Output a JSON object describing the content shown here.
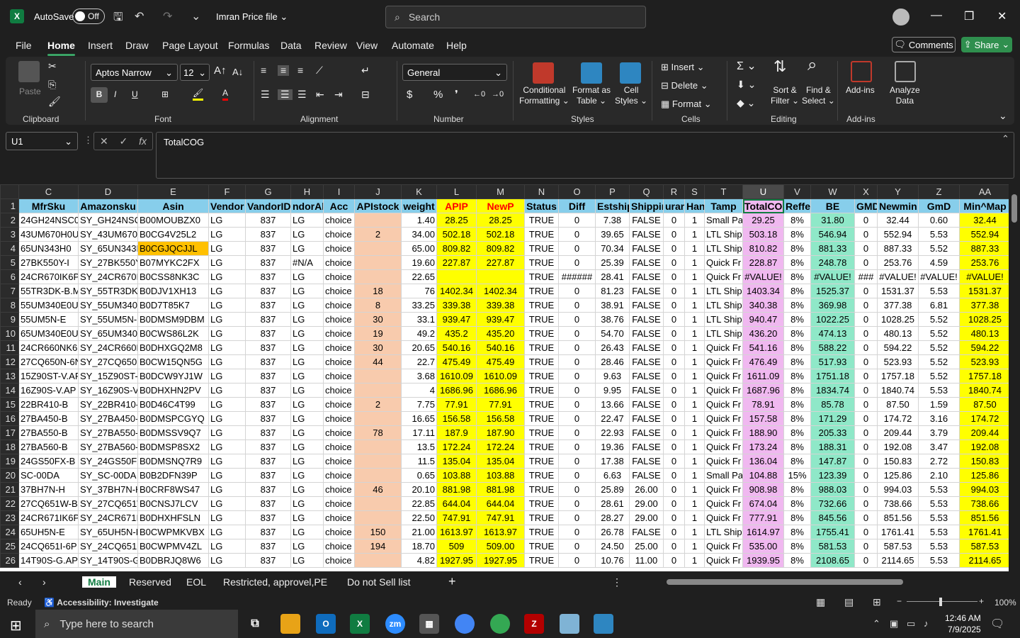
{
  "titlebar": {
    "autosave_label": "AutoSave",
    "autosave_state": "Off",
    "filename": "Imran Price file",
    "search_placeholder": "Search"
  },
  "menu": {
    "items": [
      "File",
      "Home",
      "Insert",
      "Draw",
      "Page Layout",
      "Formulas",
      "Data",
      "Review",
      "View",
      "Automate",
      "Help"
    ],
    "active": "Home",
    "comments": "Comments",
    "share": "Share"
  },
  "ribbon": {
    "clipboard": {
      "paste": "Paste",
      "label": "Clipboard"
    },
    "font": {
      "name": "Aptos Narrow",
      "size": "12",
      "label": "Font"
    },
    "alignment": {
      "label": "Alignment"
    },
    "number": {
      "format": "General",
      "label": "Number"
    },
    "styles": {
      "conditional": [
        "Conditional",
        "Formatting"
      ],
      "format_table": [
        "Format as",
        "Table"
      ],
      "cell_styles": [
        "Cell",
        "Styles"
      ],
      "label": "Styles"
    },
    "cells": {
      "insert": "Insert",
      "delete": "Delete",
      "format": "Format",
      "label": "Cells"
    },
    "editing": {
      "sort": [
        "Sort &",
        "Filter"
      ],
      "find": [
        "Find &",
        "Select"
      ],
      "label": "Editing"
    },
    "addins": {
      "addins": "Add-ins",
      "label": "Add-ins",
      "analyze": [
        "Analyze",
        "Data"
      ]
    }
  },
  "formula": {
    "namebox": "U1",
    "content": "TotalCOG"
  },
  "sheet": {
    "columns": [
      "C",
      "D",
      "E",
      "F",
      "G",
      "H",
      "I",
      "J",
      "K",
      "L",
      "M",
      "N",
      "O",
      "P",
      "Q",
      "R",
      "S",
      "T",
      "U",
      "V",
      "W",
      "X",
      "Y",
      "Z",
      "AA"
    ],
    "headers": [
      "MfrSku",
      "Amazonsku",
      "Asin",
      "Vendor",
      "VandorID",
      "ndorAll",
      "Acc",
      "APIstock",
      "weight",
      "APIP",
      "NewP",
      "Status",
      "Diff",
      "Estship",
      "Shippin",
      "uran",
      "Han",
      "Tamp",
      "TotalCOG",
      "Reffe",
      "BE",
      "GMD",
      "Newmin",
      "GmD",
      "Min^Map"
    ],
    "rows": [
      [
        "24GH24NSC0R",
        "SY_GH24NSC0R",
        "B00MOUBZX0",
        "LG",
        "837",
        "LG",
        "choice",
        "",
        "1.40",
        "28.25",
        "28.25",
        "TRUE",
        "0",
        "7.38",
        "FALSE",
        "0",
        "1",
        "Small Pa",
        "29.25",
        "8%",
        "31.80",
        "0",
        "32.44",
        "0.60",
        "32.44"
      ],
      [
        "43UM670H0U",
        "SY_43UM670H",
        "B0CG4V25L2",
        "LG",
        "837",
        "LG",
        "choice",
        "2",
        "34.00",
        "502.18",
        "502.18",
        "TRUE",
        "0",
        "39.65",
        "FALSE",
        "0",
        "1",
        "LTL Ship",
        "503.18",
        "8%",
        "546.94",
        "0",
        "552.94",
        "5.53",
        "552.94"
      ],
      [
        "65UN343H0",
        "SY_65UN343H",
        "B0CGJQCJJL",
        "LG",
        "837",
        "LG",
        "choice",
        "",
        "65.00",
        "809.82",
        "809.82",
        "TRUE",
        "0",
        "70.34",
        "FALSE",
        "0",
        "1",
        "LTL Ship",
        "810.82",
        "8%",
        "881.33",
        "0",
        "887.33",
        "5.52",
        "887.33"
      ],
      [
        "27BK550Y-I",
        "SY_27BK550Y",
        "B07MYKC2FX",
        "LG",
        "837",
        "#N/A",
        "choice",
        "",
        "19.60",
        "227.87",
        "227.87",
        "TRUE",
        "0",
        "25.39",
        "FALSE",
        "0",
        "1",
        "Quick Fr",
        "228.87",
        "8%",
        "248.78",
        "0",
        "253.76",
        "4.59",
        "253.76"
      ],
      [
        "24CR670IK6P",
        "SY_24CR670IK",
        "B0CSS8NK3C",
        "LG",
        "837",
        "LG",
        "choice",
        "",
        "22.65",
        "",
        "",
        "TRUE",
        "######",
        "28.41",
        "FALSE",
        "0",
        "1",
        "Quick Fr",
        "#VALUE!",
        "8%",
        "#VALUE!",
        "###",
        "#VALUE!",
        "#VALUE!",
        "#VALUE!"
      ],
      [
        "55TR3DK-B.M",
        "SY_55TR3DK-B",
        "B0DJV1XH13",
        "LG",
        "837",
        "LG",
        "choice",
        "18",
        "76",
        "1402.34",
        "1402.34",
        "TRUE",
        "0",
        "81.23",
        "FALSE",
        "0",
        "1",
        "LTL Ship",
        "1403.34",
        "8%",
        "1525.37",
        "0",
        "1531.37",
        "5.53",
        "1531.37"
      ],
      [
        "55UM340E0U",
        "SY_55UM340E",
        "B0D7T85K7",
        "LG",
        "837",
        "LG",
        "choice",
        "8",
        "33.25",
        "339.38",
        "339.38",
        "TRUE",
        "0",
        "38.91",
        "FALSE",
        "0",
        "1",
        "LTL Ship",
        "340.38",
        "8%",
        "369.98",
        "0",
        "377.38",
        "6.81",
        "377.38"
      ],
      [
        "55UM5N-E",
        "SY_55UM5N-E",
        "B0DMSM9DBM",
        "LG",
        "837",
        "LG",
        "choice",
        "30",
        "33.1",
        "939.47",
        "939.47",
        "TRUE",
        "0",
        "38.76",
        "FALSE",
        "0",
        "1",
        "LTL Ship",
        "940.47",
        "8%",
        "1022.25",
        "0",
        "1028.25",
        "5.52",
        "1028.25"
      ],
      [
        "65UM340E0U",
        "SY_65UM340E",
        "B0CWS86L2K",
        "LG",
        "837",
        "LG",
        "choice",
        "19",
        "49.2",
        "435.2",
        "435.20",
        "TRUE",
        "0",
        "54.70",
        "FALSE",
        "0",
        "1",
        "LTL Ship",
        "436.20",
        "8%",
        "474.13",
        "0",
        "480.13",
        "5.52",
        "480.13"
      ],
      [
        "24CR660NK6P",
        "SY_24CR660N",
        "B0DHXGQ2M8",
        "LG",
        "837",
        "LG",
        "choice",
        "30",
        "20.65",
        "540.16",
        "540.16",
        "TRUE",
        "0",
        "26.43",
        "FALSE",
        "0",
        "1",
        "Quick Fr",
        "541.16",
        "8%",
        "588.22",
        "0",
        "594.22",
        "5.52",
        "594.22"
      ],
      [
        "27CQ650N-6N",
        "SY_27CQ650N",
        "B0CW15QN5G",
        "LG",
        "837",
        "LG",
        "choice",
        "44",
        "22.7",
        "475.49",
        "475.49",
        "TRUE",
        "0",
        "28.46",
        "FALSE",
        "0",
        "1",
        "Quick Fr",
        "476.49",
        "8%",
        "517.93",
        "0",
        "523.93",
        "5.52",
        "523.93"
      ],
      [
        "15Z90ST-V.AP",
        "SY_15Z90ST-V",
        "B0DCW9YJ1W",
        "LG",
        "837",
        "LG",
        "choice",
        "",
        "3.68",
        "1610.09",
        "1610.09",
        "TRUE",
        "0",
        "9.63",
        "FALSE",
        "0",
        "1",
        "Quick Fr",
        "1611.09",
        "8%",
        "1751.18",
        "0",
        "1757.18",
        "5.52",
        "1757.18"
      ],
      [
        "16Z90S-V.AP",
        "SY_16Z90S-V.",
        "B0DHXHN2PV",
        "LG",
        "837",
        "LG",
        "choice",
        "",
        "4",
        "1686.96",
        "1686.96",
        "TRUE",
        "0",
        "9.95",
        "FALSE",
        "0",
        "1",
        "Quick Fr",
        "1687.96",
        "8%",
        "1834.74",
        "0",
        "1840.74",
        "5.53",
        "1840.74"
      ],
      [
        "22BR410-B",
        "SY_22BR410-B",
        "B0D46C4T99",
        "LG",
        "837",
        "LG",
        "choice",
        "2",
        "7.75",
        "77.91",
        "77.91",
        "TRUE",
        "0",
        "13.66",
        "FALSE",
        "0",
        "1",
        "Quick Fr",
        "78.91",
        "8%",
        "85.78",
        "0",
        "87.50",
        "1.59",
        "87.50"
      ],
      [
        "27BA450-B",
        "SY_27BA450-B",
        "B0DMSPCGYQ",
        "LG",
        "837",
        "LG",
        "choice",
        "",
        "16.65",
        "156.58",
        "156.58",
        "TRUE",
        "0",
        "22.47",
        "FALSE",
        "0",
        "1",
        "Quick Fr",
        "157.58",
        "8%",
        "171.29",
        "0",
        "174.72",
        "3.16",
        "174.72"
      ],
      [
        "27BA550-B",
        "SY_27BA550-B",
        "B0DMSSV9Q7",
        "LG",
        "837",
        "LG",
        "choice",
        "78",
        "17.11",
        "187.9",
        "187.90",
        "TRUE",
        "0",
        "22.93",
        "FALSE",
        "0",
        "1",
        "Quick Fr",
        "188.90",
        "8%",
        "205.33",
        "0",
        "209.44",
        "3.79",
        "209.44"
      ],
      [
        "27BA560-B",
        "SY_27BA560-B",
        "B0DMSP8SX2",
        "LG",
        "837",
        "LG",
        "choice",
        "",
        "13.5",
        "172.24",
        "172.24",
        "TRUE",
        "0",
        "19.36",
        "FALSE",
        "0",
        "1",
        "Quick Fr",
        "173.24",
        "8%",
        "188.31",
        "0",
        "192.08",
        "3.47",
        "192.08"
      ],
      [
        "24GS50FX-B",
        "SY_24GS50FX-",
        "B0DMSNQ7R9",
        "LG",
        "837",
        "LG",
        "choice",
        "",
        "11.5",
        "135.04",
        "135.04",
        "TRUE",
        "0",
        "17.38",
        "FALSE",
        "0",
        "1",
        "Quick Fr",
        "136.04",
        "8%",
        "147.87",
        "0",
        "150.83",
        "2.72",
        "150.83"
      ],
      [
        "SC-00DA",
        "SY_SC-00DA",
        "B0B2DFN39P",
        "LG",
        "837",
        "LG",
        "choice",
        "",
        "0.65",
        "103.88",
        "103.88",
        "TRUE",
        "0",
        "6.63",
        "FALSE",
        "0",
        "1",
        "Small Pa",
        "104.88",
        "15%",
        "123.39",
        "0",
        "125.86",
        "2.10",
        "125.86"
      ],
      [
        "37BH7N-H",
        "SY_37BH7N-H",
        "B0CRF8WS47",
        "LG",
        "837",
        "LG",
        "choice",
        "46",
        "20.10",
        "881.98",
        "881.98",
        "TRUE",
        "0",
        "25.89",
        "26.00",
        "0",
        "1",
        "Quick Fr",
        "908.98",
        "8%",
        "988.03",
        "0",
        "994.03",
        "5.53",
        "994.03"
      ],
      [
        "27CQ651W-B",
        "SY_27CQ651W",
        "B0CNSJ7LCV",
        "LG",
        "837",
        "LG",
        "choice",
        "",
        "22.85",
        "644.04",
        "644.04",
        "TRUE",
        "0",
        "28.61",
        "29.00",
        "0",
        "1",
        "Quick Fr",
        "674.04",
        "8%",
        "732.66",
        "0",
        "738.66",
        "5.53",
        "738.66"
      ],
      [
        "24CR671IK6P",
        "SY_24CR671IK",
        "B0DHXHFSLN",
        "LG",
        "837",
        "LG",
        "choice",
        "",
        "22.50",
        "747.91",
        "747.91",
        "TRUE",
        "0",
        "28.27",
        "29.00",
        "0",
        "1",
        "Quick Fr",
        "777.91",
        "8%",
        "845.56",
        "0",
        "851.56",
        "5.53",
        "851.56"
      ],
      [
        "65UH5N-E",
        "SY_65UH5N-E",
        "B0CWPMKVBX",
        "LG",
        "837",
        "LG",
        "choice",
        "150",
        "21.00",
        "1613.97",
        "1613.97",
        "TRUE",
        "0",
        "26.78",
        "FALSE",
        "0",
        "1",
        "LTL Ship",
        "1614.97",
        "8%",
        "1755.41",
        "0",
        "1761.41",
        "5.53",
        "1761.41"
      ],
      [
        "24CQ651I-6P",
        "SY_24CQ651I-",
        "B0CWPMV4ZL",
        "LG",
        "837",
        "LG",
        "choice",
        "194",
        "18.70",
        "509",
        "509.00",
        "TRUE",
        "0",
        "24.50",
        "25.00",
        "0",
        "1",
        "Quick Fr",
        "535.00",
        "8%",
        "581.53",
        "0",
        "587.53",
        "5.53",
        "587.53"
      ],
      [
        "14T90S-G.APE",
        "SY_14T90S-G.",
        "B0DBRJQ8W6",
        "LG",
        "837",
        "LG",
        "choice",
        "",
        "4.82",
        "1927.95",
        "1927.95",
        "TRUE",
        "0",
        "10.76",
        "11.00",
        "0",
        "1",
        "Quick Fr",
        "1939.95",
        "8%",
        "2108.65",
        "0",
        "2114.65",
        "5.53",
        "2114.65"
      ]
    ]
  },
  "tabs": {
    "items": [
      "Main",
      "Reserved",
      "EOL",
      "Restricted, approvel,PE",
      "Do not Sell list"
    ],
    "active": "Main"
  },
  "status": {
    "ready": "Ready",
    "accessibility": "Accessibility: Investigate",
    "zoom": "100%"
  },
  "taskbar": {
    "search_placeholder": "Type here to search",
    "time": "12:46 AM",
    "date": "7/9/2025"
  },
  "colors": {
    "excel_green": "#107c41",
    "header_blue": "#87ceeb",
    "yellow": "#ffff00",
    "salmon": "#f8cbad",
    "pink": "#f0b8f0",
    "mint": "#8fe8c8"
  }
}
